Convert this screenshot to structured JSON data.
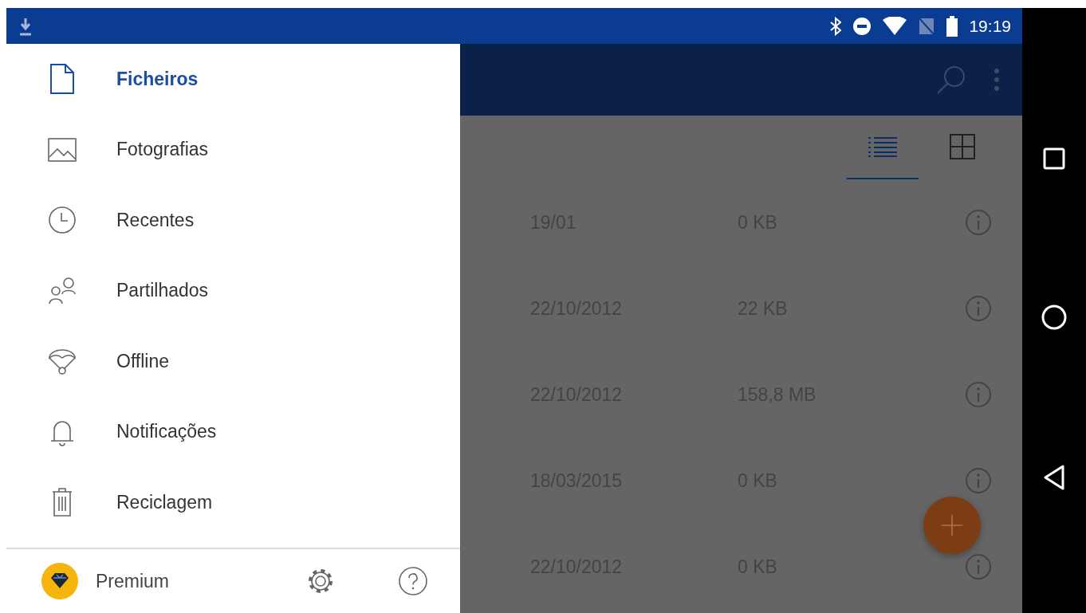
{
  "status_bar": {
    "time": "19:19"
  },
  "drawer": {
    "items": [
      {
        "label": "Ficheiros",
        "selected": true
      },
      {
        "label": "Fotografias",
        "selected": false
      },
      {
        "label": "Recentes",
        "selected": false
      },
      {
        "label": "Partilhados",
        "selected": false
      },
      {
        "label": "Offline",
        "selected": false
      },
      {
        "label": "Notificações",
        "selected": false
      },
      {
        "label": "Reciclagem",
        "selected": false
      }
    ],
    "premium_label": "Premium"
  },
  "view_modes": [
    {
      "kind": "list",
      "selected": true
    },
    {
      "kind": "grid",
      "selected": false
    }
  ],
  "files": [
    {
      "date": "19/01",
      "size": "0 KB"
    },
    {
      "date": "22/10/2012",
      "size": "22 KB"
    },
    {
      "date": "22/10/2012",
      "size": "158,8 MB"
    },
    {
      "date": "18/03/2015",
      "size": "0 KB"
    },
    {
      "date": "22/10/2012",
      "size": "0 KB"
    }
  ]
}
